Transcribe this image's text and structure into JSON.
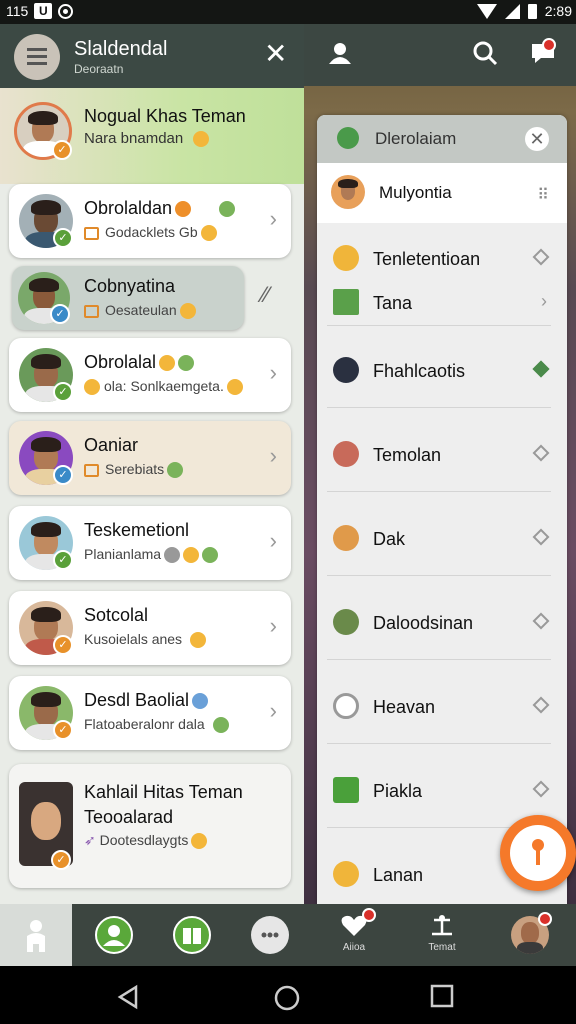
{
  "status": {
    "time_left": "115",
    "time_right": "2:89",
    "icons": [
      "notification-icon",
      "sync-icon",
      "wifi-icon",
      "signal-icon",
      "battery-icon"
    ]
  },
  "drawer": {
    "title": "Slaldendal",
    "subtitle": "Deoraatn",
    "hero": {
      "name": "Nogual Khas Teman",
      "status": "Nara bnamdan"
    },
    "contacts": [
      {
        "name": "Obrolaldan",
        "status": "Godacklets Gb",
        "badge": "green"
      },
      {
        "name": "Cobnyatina",
        "status": "Oesateulan",
        "badge": "blue"
      },
      {
        "name": "Obrolalal",
        "status": "ola: Sonlkaemgeta.",
        "badge": "green"
      },
      {
        "name": "Oaniar",
        "status": "Serebiats",
        "badge": "blue"
      },
      {
        "name": "Teskemetionl",
        "status": "Planianlama",
        "badge": "green"
      },
      {
        "name": "Sotcolal",
        "status": "Kusoielals anes",
        "badge": "orange"
      },
      {
        "name": "Desdl Baolial",
        "status": "Flatoaberalonr dala",
        "badge": "orange"
      },
      {
        "name": "Kahlail Hitas Teman Teooalarad",
        "status": "Dootesdlaygts",
        "badge": "orange"
      }
    ]
  },
  "panel": {
    "title": "Dlerolaiam",
    "selected": "Mulyontia",
    "items": [
      {
        "label": "Tenletentioan",
        "mark": "diamond"
      },
      {
        "label": "Tana",
        "mark": "chevron"
      },
      {
        "label": "Fhahlcaotis",
        "mark": "filled"
      },
      {
        "label": "Temolan",
        "mark": "diamond"
      },
      {
        "label": "Dak",
        "mark": "diamond"
      },
      {
        "label": "Daloodsinan",
        "mark": "diamond"
      },
      {
        "label": "Heavan",
        "mark": "diamond"
      },
      {
        "label": "Piakla",
        "mark": "diamond"
      },
      {
        "label": "Lanan",
        "mark": "none"
      }
    ]
  },
  "tabs": [
    {
      "label": "",
      "icon": "person-icon"
    },
    {
      "label": "",
      "icon": "contact-icon"
    },
    {
      "label": "",
      "icon": "book-icon"
    },
    {
      "label": "",
      "icon": "more-icon"
    },
    {
      "label": "Aiioa",
      "icon": "heart-icon"
    },
    {
      "label": "Temat",
      "icon": "scale-icon"
    },
    {
      "label": "",
      "icon": "profile-icon"
    }
  ],
  "colors": {
    "header": "#3c4944",
    "accent_orange": "#f5792a",
    "accent_green": "#4aa03a"
  }
}
